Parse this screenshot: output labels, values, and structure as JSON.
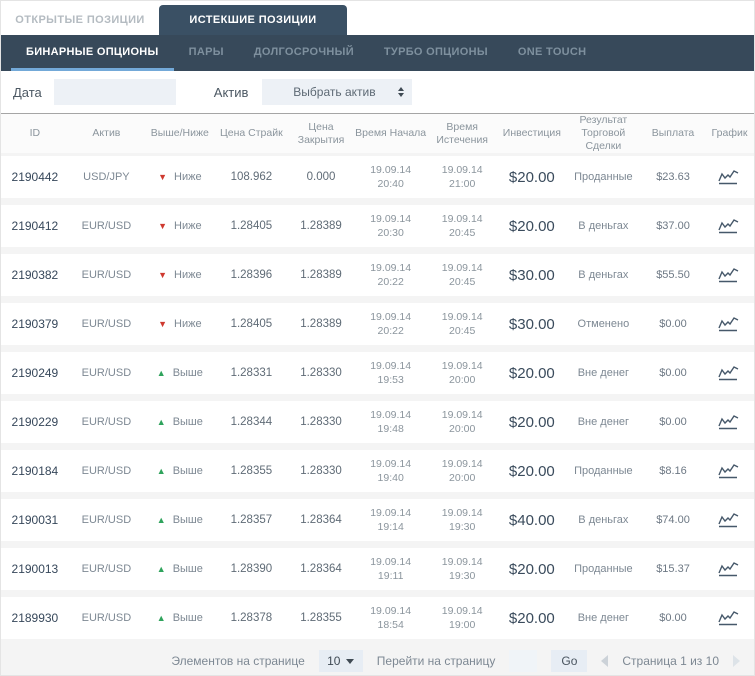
{
  "tabs": [
    {
      "label": "ОТКРЫТЫЕ ПОЗИЦИИ",
      "active": false
    },
    {
      "label": "ИСТЕКШИЕ ПОЗИЦИИ",
      "active": true
    }
  ],
  "nav": {
    "items": [
      {
        "label": "БИНАРНЫЕ ОПЦИОНЫ",
        "active": true
      },
      {
        "label": "ПАРЫ",
        "active": false
      },
      {
        "label": "ДОЛГОСРОЧНЫЙ",
        "active": false
      },
      {
        "label": "ТУРБО ОПЦИОНЫ",
        "active": false
      },
      {
        "label": "ONE TOUCH",
        "active": false
      }
    ]
  },
  "filters": {
    "date_label": "Дата",
    "asset_label": "Актив",
    "asset_selected": "Выбрать актив"
  },
  "colors": {
    "dark_slate": "#37495a",
    "tab_active": "#3a5064",
    "nav_underline": "#73a9d8",
    "up_green": "#2fa35c",
    "down_red": "#cf3a30"
  },
  "table": {
    "columns": [
      "ID",
      "Актив",
      "Выше/Ниже",
      "Цена Страйк",
      "Цена Закрытия",
      "Время Начала",
      "Время Истечения",
      "Инвестиция",
      "Результат Торговой Сделки",
      "Выплата",
      "График"
    ],
    "rows": [
      {
        "id": "2190442",
        "asset": "USD/JPY",
        "direction": "down",
        "direction_label": "Ниже",
        "strike_price": "108.962",
        "close_price": "0.000",
        "start_date": "19.09.14",
        "start_time": "20:40",
        "expiry_date": "19.09.14",
        "expiry_time": "21:00",
        "investment": "$20.00",
        "result": "Проданные",
        "payout": "$23.63"
      },
      {
        "id": "2190412",
        "asset": "EUR/USD",
        "direction": "down",
        "direction_label": "Ниже",
        "strike_price": "1.28405",
        "close_price": "1.28389",
        "start_date": "19.09.14",
        "start_time": "20:30",
        "expiry_date": "19.09.14",
        "expiry_time": "20:45",
        "investment": "$20.00",
        "result": "В деньгах",
        "payout": "$37.00"
      },
      {
        "id": "2190382",
        "asset": "EUR/USD",
        "direction": "down",
        "direction_label": "Ниже",
        "strike_price": "1.28396",
        "close_price": "1.28389",
        "start_date": "19.09.14",
        "start_time": "20:22",
        "expiry_date": "19.09.14",
        "expiry_time": "20:45",
        "investment": "$30.00",
        "result": "В деньгах",
        "payout": "$55.50"
      },
      {
        "id": "2190379",
        "asset": "EUR/USD",
        "direction": "down",
        "direction_label": "Ниже",
        "strike_price": "1.28405",
        "close_price": "1.28389",
        "start_date": "19.09.14",
        "start_time": "20:22",
        "expiry_date": "19.09.14",
        "expiry_time": "20:45",
        "investment": "$30.00",
        "result": "Отменено",
        "payout": "$0.00"
      },
      {
        "id": "2190249",
        "asset": "EUR/USD",
        "direction": "up",
        "direction_label": "Выше",
        "strike_price": "1.28331",
        "close_price": "1.28330",
        "start_date": "19.09.14",
        "start_time": "19:53",
        "expiry_date": "19.09.14",
        "expiry_time": "20:00",
        "investment": "$20.00",
        "result": "Вне денег",
        "payout": "$0.00"
      },
      {
        "id": "2190229",
        "asset": "EUR/USD",
        "direction": "up",
        "direction_label": "Выше",
        "strike_price": "1.28344",
        "close_price": "1.28330",
        "start_date": "19.09.14",
        "start_time": "19:48",
        "expiry_date": "19.09.14",
        "expiry_time": "20:00",
        "investment": "$20.00",
        "result": "Вне денег",
        "payout": "$0.00"
      },
      {
        "id": "2190184",
        "asset": "EUR/USD",
        "direction": "up",
        "direction_label": "Выше",
        "strike_price": "1.28355",
        "close_price": "1.28330",
        "start_date": "19.09.14",
        "start_time": "19:40",
        "expiry_date": "19.09.14",
        "expiry_time": "20:00",
        "investment": "$20.00",
        "result": "Проданные",
        "payout": "$8.16"
      },
      {
        "id": "2190031",
        "asset": "EUR/USD",
        "direction": "up",
        "direction_label": "Выше",
        "strike_price": "1.28357",
        "close_price": "1.28364",
        "start_date": "19.09.14",
        "start_time": "19:14",
        "expiry_date": "19.09.14",
        "expiry_time": "19:30",
        "investment": "$40.00",
        "result": "В деньгах",
        "payout": "$74.00"
      },
      {
        "id": "2190013",
        "asset": "EUR/USD",
        "direction": "up",
        "direction_label": "Выше",
        "strike_price": "1.28390",
        "close_price": "1.28364",
        "start_date": "19.09.14",
        "start_time": "19:11",
        "expiry_date": "19.09.14",
        "expiry_time": "19:30",
        "investment": "$20.00",
        "result": "Проданные",
        "payout": "$15.37"
      },
      {
        "id": "2189930",
        "asset": "EUR/USD",
        "direction": "up",
        "direction_label": "Выше",
        "strike_price": "1.28378",
        "close_price": "1.28355",
        "start_date": "19.09.14",
        "start_time": "18:54",
        "expiry_date": "19.09.14",
        "expiry_time": "19:00",
        "investment": "$20.00",
        "result": "Вне денег",
        "payout": "$0.00"
      }
    ]
  },
  "footer": {
    "items_per_page_label": "Элементов на странице",
    "items_per_page_value": "10",
    "goto_label": "Перейти на страницу",
    "goto_value": "",
    "go_label": "Go",
    "page_status": "Страница 1 из 10"
  }
}
